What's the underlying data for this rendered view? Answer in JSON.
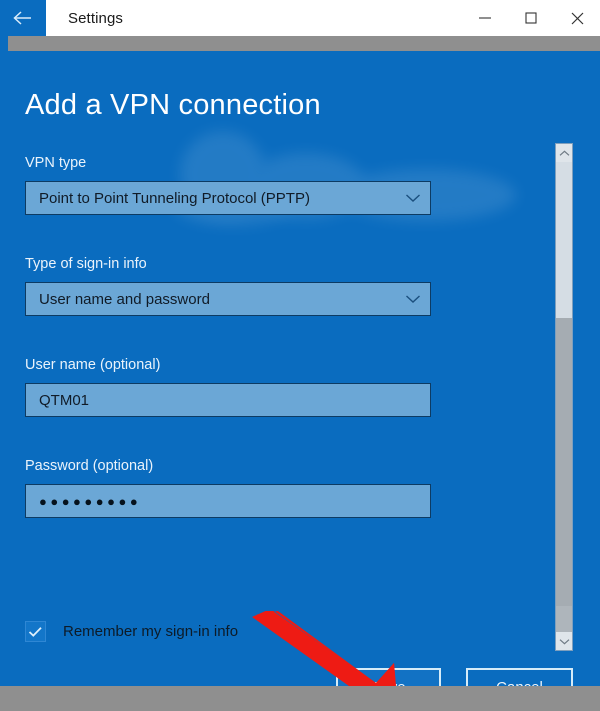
{
  "window": {
    "title": "Settings",
    "back_icon": "back-arrow-icon",
    "minimize_label": "─",
    "maximize_label": "☐",
    "close_label": "✕"
  },
  "page": {
    "heading": "Add a VPN connection"
  },
  "fields": [
    {
      "id": "vpn-type",
      "label": "VPN type",
      "value": "Point to Point Tunneling Protocol (PPTP)",
      "kind": "dropdown"
    },
    {
      "id": "sign-in-type",
      "label": "Type of sign-in info",
      "value": "User name and password",
      "kind": "dropdown"
    },
    {
      "id": "user-name",
      "label": "User name (optional)",
      "value": "QTM01",
      "kind": "text"
    },
    {
      "id": "password",
      "label": "Password (optional)",
      "value": "●●●●●●●●●",
      "kind": "password"
    }
  ],
  "checkbox": {
    "label": "Remember my sign-in info",
    "checked": true
  },
  "buttons": {
    "save": "Save",
    "cancel": "Cancel"
  },
  "scrollbar": {
    "up_icon": "chevron-up-icon",
    "down_icon": "chevron-down-icon"
  },
  "annotation": {
    "arrow_color": "#ee1b14",
    "points_to": "Save"
  },
  "colors": {
    "accent_blue": "#0a6cbf",
    "field_fill": "#6ba7d6",
    "field_border": "#0d3b63",
    "desktop_gray": "#8f8f8f"
  }
}
